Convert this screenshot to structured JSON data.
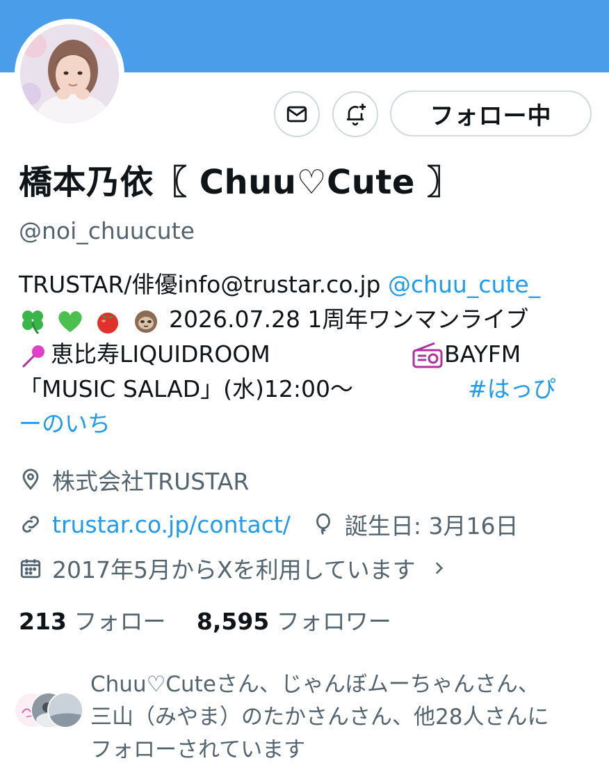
{
  "profile": {
    "display_name": "橋本乃依〖 Chuu♡Cute 〗",
    "handle": "@noi_chuucute",
    "follow_button_label": "フォロー中",
    "bio": {
      "line1_text": "TRUSTAR/俳優info@trustar.co.jp ",
      "line1_mention": "@chuu_cute_",
      "line2_text": "2026.07.28 1周年ワンマンライブ",
      "line3_text": "恵比寿LIQUIDROOM",
      "line3_right": "BAYFM",
      "line4_text": "「MUSIC SALAD」(水)12:00〜",
      "line4_hashtag": "#はっぴ",
      "line5_hashtag": "ーのいち"
    },
    "location": "株式会社TRUSTAR",
    "website": "trustar.co.jp/contact/",
    "birthday": "誕生日: 3月16日",
    "joined": "2017年5月からXを利用しています",
    "following_count": "213",
    "following_label": "フォロー",
    "followers_count": "8,595",
    "followers_label": "フォロワー",
    "followed_by": {
      "line1": "Chuu♡Cuteさん、じゃんぼムーちゃんさん、",
      "line2": "三山（みやま）のたかさんさん、他28人さんに",
      "line3": "フォローされています"
    }
  },
  "icons": {
    "dm": "mail-icon",
    "notify": "bell-plus-icon",
    "location": "location-pin-icon",
    "website": "link-icon",
    "birthday": "balloon-icon",
    "joined": "calendar-icon",
    "chevron": "chevron-right-icon"
  },
  "colors": {
    "banner": "#4a9de8",
    "link": "#1d9bf0",
    "secondary_text": "#536471"
  }
}
